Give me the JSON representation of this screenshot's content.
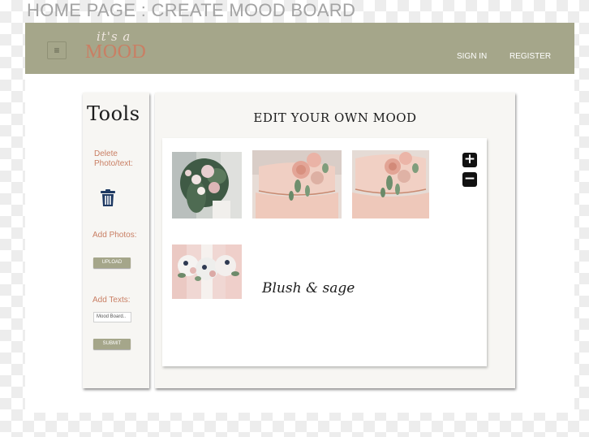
{
  "page_heading": "HOME PAGE : CREATE MOOD BOARD",
  "navbar": {
    "menu_icon": "≡",
    "logo_script": "it's a",
    "logo_main": "MOOD",
    "signin_label": "SIGN IN",
    "register_label": "REGISTER"
  },
  "tools": {
    "title": "Tools",
    "delete_label": "Delete Photo/text:",
    "trash_icon": "trash-icon",
    "add_photos_label": "Add Photos:",
    "upload_label": "UPLOAD",
    "add_texts_label": "Add Texts:",
    "text_input_value": "Mood Board..",
    "submit_label": "SUBMIT"
  },
  "editor": {
    "title": "EDIT YOUR OWN MOOD",
    "caption": "Blush & sage",
    "zoom_in_icon": "+",
    "zoom_out_icon": "−",
    "photos": [
      {
        "name": "bridal-bouquet-photo",
        "icon": "bouquet-icon"
      },
      {
        "name": "wedding-cake-photo",
        "icon": "cake-icon"
      },
      {
        "name": "wedding-cake-closeup-photo",
        "icon": "cake-icon"
      },
      {
        "name": "bridesmaids-bouquets-photo",
        "icon": "bouquet-icon"
      }
    ]
  },
  "colors": {
    "navbar": "#a5a68a",
    "accent": "#c97f64",
    "panel": "#f7f6f3",
    "trash": "#1f3a63"
  }
}
